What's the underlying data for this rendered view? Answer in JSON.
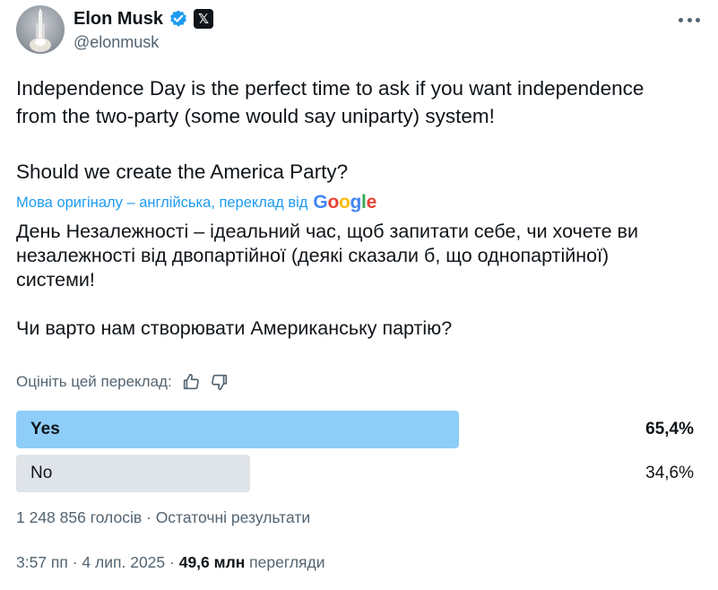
{
  "author": {
    "name": "Elon Musk",
    "handle": "@elonmusk",
    "avatar_icon": "rocket-launch-avatar",
    "verified_icon": "verified-badge-icon",
    "affiliation_icon": "x-logo-icon",
    "x_glyph": "𝕏",
    "more_icon": "more-dots-icon"
  },
  "tweet": {
    "line1": "Independence Day is the perfect time to ask if you want independence",
    "line2": "from the two-party (some would say uniparty) system!",
    "line3": "Should we create the America Party?"
  },
  "translation_note": {
    "text": "Мова оригіналу – англійська, переклад від",
    "provider": "Google",
    "provider_letters": [
      "G",
      "o",
      "o",
      "g",
      "l",
      "e"
    ],
    "provider_colors": [
      "#4285F4",
      "#EA4335",
      "#FBBC05",
      "#4285F4",
      "#34A853",
      "#EA4335"
    ]
  },
  "translation": {
    "line1": "День Незалежності – ідеальний час, щоб запитати себе, чи хочете ви",
    "line2": "незалежності від двопартійної (деякі сказали б, що однопартійної)",
    "line3": "системи!",
    "line4": "Чи варто нам створювати Американську партію?"
  },
  "rating": {
    "label": "Оцініть цей переклад:",
    "up_icon": "thumbs-up-icon",
    "down_icon": "thumbs-down-icon"
  },
  "poll": {
    "options": [
      {
        "label": "Yes",
        "percent_text": "65,4%",
        "share": 0.654,
        "winner": true
      },
      {
        "label": "No",
        "percent_text": "34,6%",
        "share": 0.346,
        "winner": false
      }
    ],
    "meta": "1 248 856 голосів · Остаточні результати"
  },
  "footer": {
    "time": "3:57 пп · 4 лип. 2025 ·",
    "views_count": "49,6 млн",
    "views_label": "перегляди"
  },
  "colors": {
    "accent": "#1d9bf0",
    "poll_winner": "#8ecdf8",
    "poll_other": "#dfe4e8",
    "secondary_text": "#536471"
  }
}
